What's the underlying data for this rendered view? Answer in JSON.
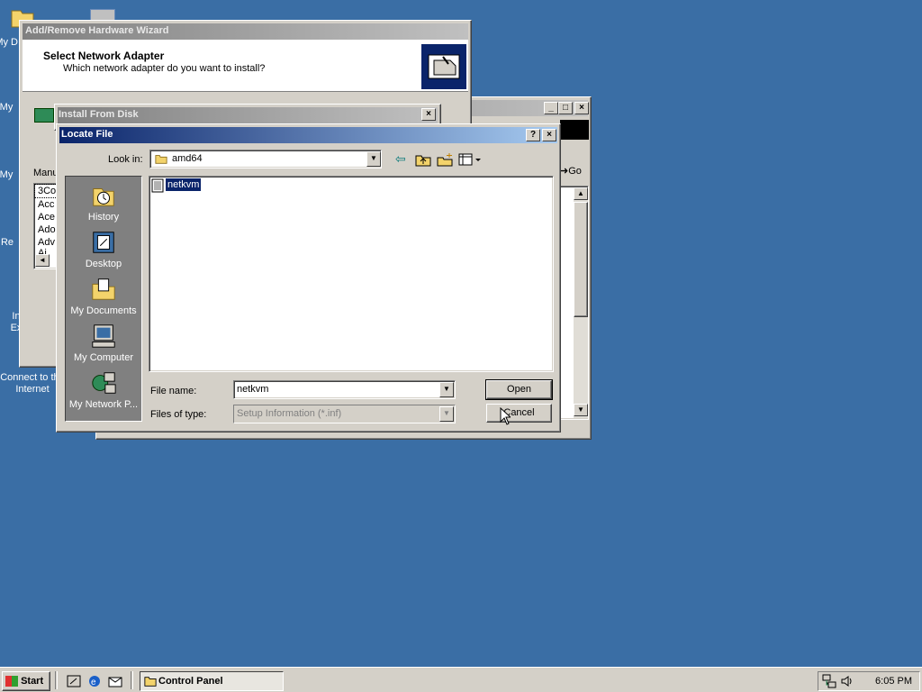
{
  "desktop": {
    "icons": [
      {
        "label": "My D",
        "icon": "my-documents-icon"
      },
      {
        "label": "My",
        "icon": "my-computer-icon"
      },
      {
        "label": "My",
        "icon": "my-network-icon"
      },
      {
        "label": "Re",
        "icon": "recycle-bin-icon"
      },
      {
        "label": "In Ex",
        "icon": "internet-explorer-icon"
      },
      {
        "label": "Connect to the Internet",
        "icon": "connect-internet-icon"
      }
    ]
  },
  "back_window": {
    "go_label": "Go"
  },
  "wizard": {
    "title": "Add/Remove Hardware Wizard",
    "heading": "Select Network Adapter",
    "subheading": "Which network adapter do you want to install?",
    "manufacturer_label": "Manu",
    "manufacturers": [
      "3Co",
      "Acc",
      "Ace",
      "Ado",
      "Adv",
      "Ai"
    ]
  },
  "install_from_disk": {
    "title": "Install From Disk"
  },
  "locate_file": {
    "title": "Locate File",
    "help_label": "?",
    "close_label": "×",
    "look_in_label": "Look in:",
    "look_in_value": "amd64",
    "places": [
      {
        "label": "History",
        "icon": "history-icon"
      },
      {
        "label": "Desktop",
        "icon": "desktop-icon"
      },
      {
        "label": "My Documents",
        "icon": "my-documents-icon"
      },
      {
        "label": "My Computer",
        "icon": "my-computer-icon"
      },
      {
        "label": "My Network P...",
        "icon": "my-network-places-icon"
      }
    ],
    "files": [
      {
        "name": "netkvm",
        "selected": true
      }
    ],
    "file_name_label": "File name:",
    "file_name_value": "netkvm",
    "files_of_type_label": "Files of type:",
    "files_of_type_value": "Setup Information (*.inf)",
    "open_label": "Open",
    "cancel_label": "Cancel"
  },
  "taskbar": {
    "start_label": "Start",
    "tasks": [
      {
        "label": "Control Panel",
        "icon": "control-panel-icon"
      }
    ],
    "clock": "6:05 PM"
  },
  "colors": {
    "desktop": "#3a6ea5",
    "face": "#d4d0c8",
    "active_title": "#0a246a",
    "inactive_title": "#808080",
    "selection": "#0a246a"
  }
}
